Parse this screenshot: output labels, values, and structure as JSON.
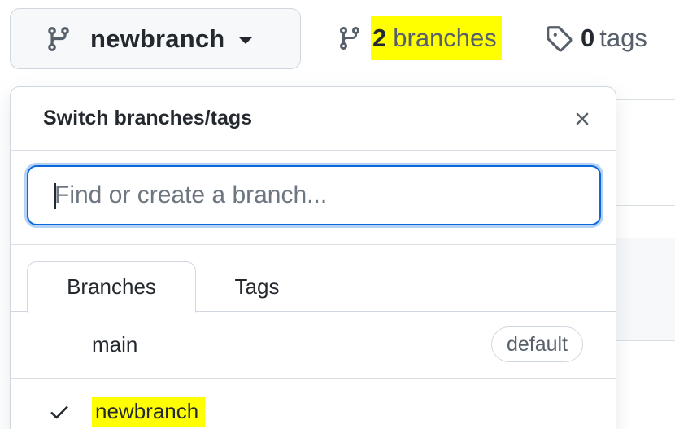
{
  "branch_selector": {
    "current_branch": "newbranch"
  },
  "branches_link": {
    "count": "2",
    "word": "branches"
  },
  "tags_link": {
    "count": "0",
    "word": "tags"
  },
  "popover": {
    "title": "Switch branches/tags",
    "search": {
      "value": "",
      "placeholder": "Find or create a branch..."
    },
    "tabs": [
      {
        "label": "Branches",
        "active": true
      },
      {
        "label": "Tags",
        "active": false
      }
    ],
    "branches": [
      {
        "name": "main",
        "badge": "default",
        "selected": false
      },
      {
        "name": "newbranch",
        "badge": "",
        "selected": true
      }
    ]
  },
  "colors": {
    "highlight": "#ffff00",
    "focus_ring": "#0969da",
    "text": "#24292f",
    "muted": "#57606a"
  },
  "icons": {
    "branch": "git-branch-icon",
    "tag": "tag-icon",
    "close": "close-icon",
    "check": "check-icon",
    "dropdown": "triangle-down-icon"
  }
}
